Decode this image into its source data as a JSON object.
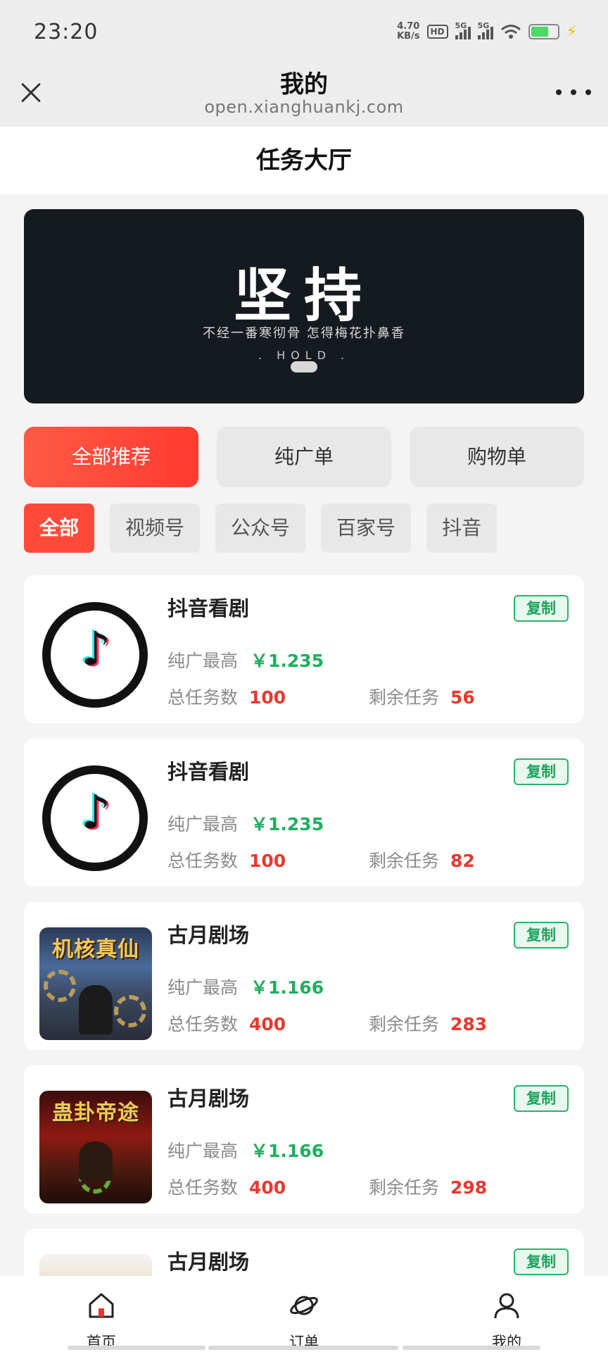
{
  "status_bar": {
    "time": "23:20",
    "speed_value": "4.70",
    "speed_unit": "KB/s",
    "hd_label": "HD",
    "signal1_label": "5G",
    "signal2_label": "5G",
    "battery_level": 0.6
  },
  "title_bar": {
    "title": "我的",
    "url": "open.xianghuankj.com"
  },
  "page": {
    "header": "任务大厅"
  },
  "banner": {
    "title": "坚持",
    "subtitle": "不经一番寒彻骨  怎得梅花扑鼻香",
    "tagline": ". HOLD ."
  },
  "category_tabs": [
    {
      "label": "全部推荐",
      "active": true
    },
    {
      "label": "纯广单",
      "active": false
    },
    {
      "label": "购物单",
      "active": false
    }
  ],
  "sub_tabs": [
    {
      "label": "全部",
      "active": true
    },
    {
      "label": "视频号",
      "active": false
    },
    {
      "label": "公众号",
      "active": false
    },
    {
      "label": "百家号",
      "active": false
    },
    {
      "label": "抖音",
      "active": false
    }
  ],
  "task_labels": {
    "price_label": "纯广最高",
    "total_label": "总任务数",
    "remaining_label": "剩余任务",
    "copy_label": "复制"
  },
  "tasks": [
    {
      "name": "抖音看剧",
      "price": "￥1.235",
      "total": "100",
      "remaining": "56",
      "thumb": "tiktok-logo"
    },
    {
      "name": "抖音看剧",
      "price": "￥1.235",
      "total": "100",
      "remaining": "82",
      "thumb": "tiktok-logo"
    },
    {
      "name": "古月剧场",
      "price": "￥1.166",
      "total": "400",
      "remaining": "283",
      "thumb": "drama-poster",
      "poster_title": "机核真仙"
    },
    {
      "name": "古月剧场",
      "price": "￥1.166",
      "total": "400",
      "remaining": "298",
      "thumb": "drama-poster",
      "poster_title": "蛊卦帝途"
    },
    {
      "name": "古月剧场",
      "thumb": "drama-poster"
    }
  ],
  "bottom_nav": {
    "items": [
      {
        "label": "首页",
        "icon": "home-icon"
      },
      {
        "label": "订单",
        "icon": "planet-icon"
      },
      {
        "label": "我的",
        "icon": "user-icon"
      }
    ]
  }
}
